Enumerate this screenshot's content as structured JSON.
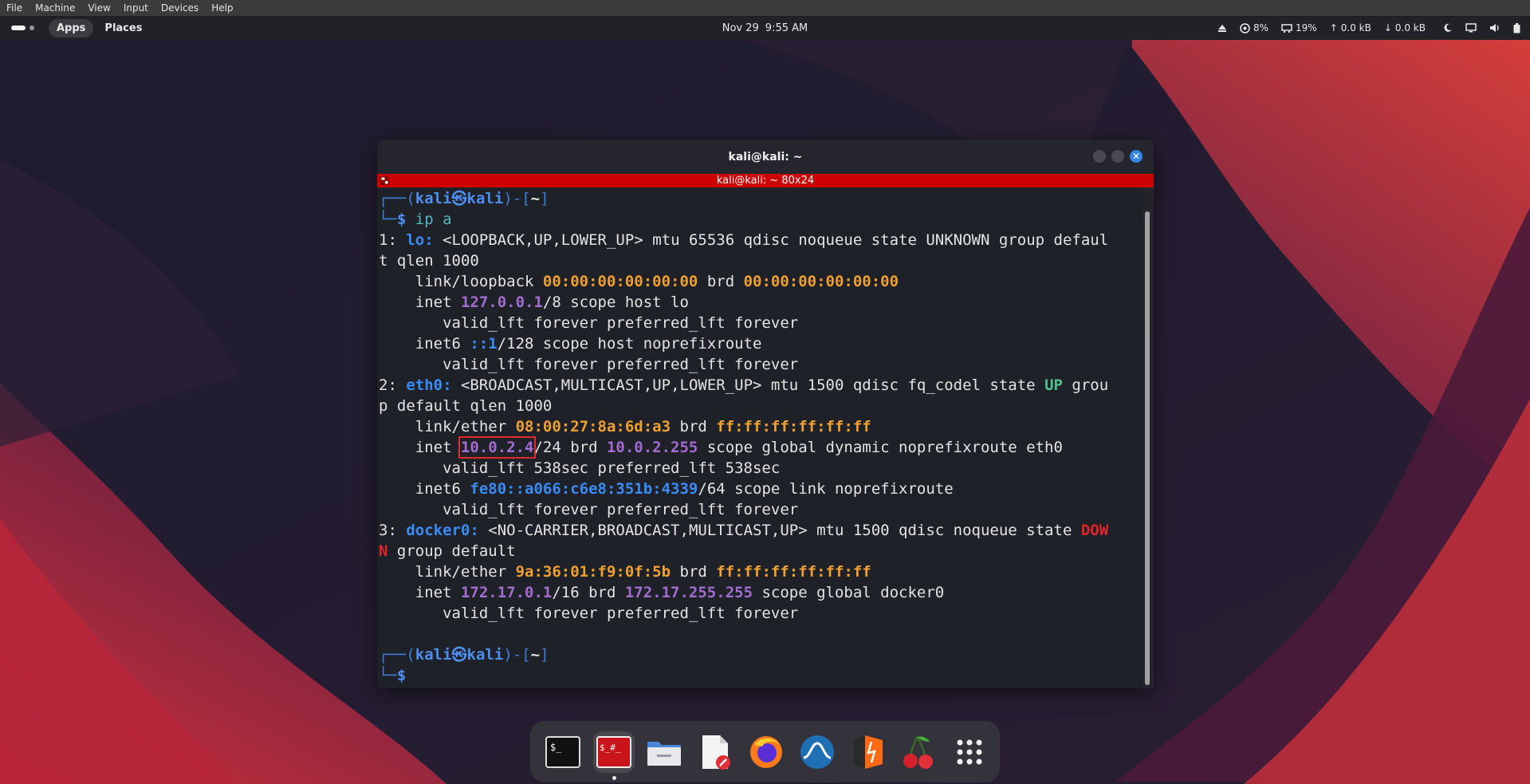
{
  "vbox_menu": [
    "File",
    "Machine",
    "View",
    "Input",
    "Devices",
    "Help"
  ],
  "topbar": {
    "apps_label": "Apps",
    "places_label": "Places",
    "date": "Nov 29",
    "time": "9:55 AM",
    "cpu": "8%",
    "mem": "19%",
    "net_up": "0.0 kB",
    "net_down": "0.0 kB"
  },
  "terminal": {
    "window_title": "kali@kali: ~",
    "tab_title": "kali@kali: ~ 80x24",
    "prompt": {
      "open": "┌──(",
      "user": "kali",
      "at": "㉿",
      "host": "kali",
      "mid": ")-[",
      "dir": "~",
      "close": "]",
      "line2": "└─",
      "dollar": "$"
    },
    "command": "ip a",
    "lines": {
      "l1_num": "1: ",
      "l1_if": "lo:",
      "l1_rest": " <LOOPBACK,UP,LOWER_UP> mtu 65536 qdisc noqueue state UNKNOWN group defaul",
      "l2": "t qlen 1000",
      "l3_a": "    link/loopback ",
      "l3_mac": "00:00:00:00:00:00",
      "l3_b": " brd ",
      "l3_brd": "00:00:00:00:00:00",
      "l4_a": "    inet ",
      "l4_ip": "127.0.0.1",
      "l4_b": "/8 scope host lo",
      "l5": "       valid_lft forever preferred_lft forever",
      "l6_a": "    inet6 ",
      "l6_ip": "::1",
      "l6_b": "/128 scope host noprefixroute",
      "l7": "       valid_lft forever preferred_lft forever",
      "l8_num": "2: ",
      "l8_if": "eth0:",
      "l8_rest": " <BROADCAST,MULTICAST,UP,LOWER_UP> mtu 1500 qdisc fq_codel state ",
      "l8_state": "UP",
      "l8_end": " grou",
      "l9": "p default qlen 1000",
      "l10_a": "    link/ether ",
      "l10_mac": "08:00:27:8a:6d:a3",
      "l10_b": " brd ",
      "l10_brd": "ff:ff:ff:ff:ff:ff",
      "l11_a": "    inet ",
      "l11_ip": "10.0.2.4",
      "l11_b": "/24 brd ",
      "l11_brd": "10.0.2.255",
      "l11_c": " scope global dynamic noprefixroute eth0",
      "l12": "       valid_lft 538sec preferred_lft 538sec",
      "l13_a": "    inet6 ",
      "l13_ip": "fe80::a066:c6e8:351b:4339",
      "l13_b": "/64 scope link noprefixroute",
      "l14": "       valid_lft forever preferred_lft forever",
      "l15_num": "3: ",
      "l15_if": "docker0:",
      "l15_rest": " <NO-CARRIER,BROADCAST,MULTICAST,UP> mtu 1500 qdisc noqueue state ",
      "l15_state": "DOW",
      "l16_state": "N",
      "l16_rest": " group default",
      "l17_a": "    link/ether ",
      "l17_mac": "9a:36:01:f9:0f:5b",
      "l17_b": " brd ",
      "l17_brd": "ff:ff:ff:ff:ff:ff",
      "l18_a": "    inet ",
      "l18_ip": "172.17.0.1",
      "l18_b": "/16 brd ",
      "l18_brd": "172.17.255.255",
      "l18_c": " scope global docker0",
      "l19": "       valid_lft forever preferred_lft forever"
    }
  },
  "dock": {
    "items": [
      "terminal",
      "root-terminal",
      "files",
      "text-editor",
      "firefox",
      "wireshark",
      "burp-suite",
      "cherrytree",
      "show-apps"
    ],
    "terminal_glyph": "$_",
    "root_terminal_glyph": "$_#_"
  },
  "colors": {
    "tab_bar": "#cc0000",
    "prompt_blue": "#4d8ef0",
    "highlight_box": "#e02b2b"
  }
}
